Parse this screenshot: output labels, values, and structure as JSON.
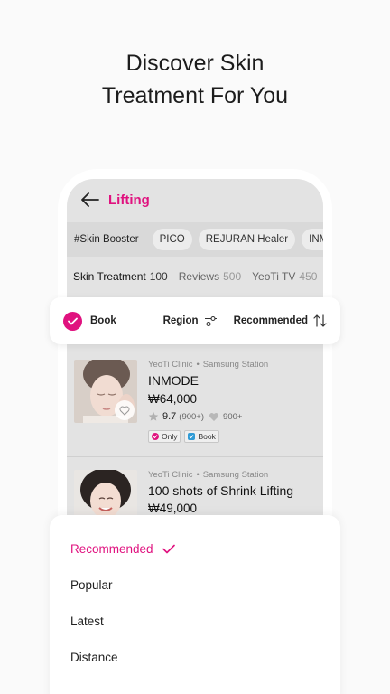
{
  "headline": {
    "line1": "Discover Skin",
    "line2": "Treatment For You"
  },
  "topbar": {
    "title": "Lifting"
  },
  "tags": [
    "#Skin Booster",
    "PICO",
    "REJURAN Healer",
    "INMODE"
  ],
  "subtabs": [
    {
      "label": "Skin Treatment",
      "count": "100"
    },
    {
      "label": "Reviews",
      "count": "500"
    },
    {
      "label": "YeoTi TV",
      "count": "450"
    }
  ],
  "filters": {
    "book": "Book",
    "region": "Region",
    "sort": "Recommended"
  },
  "items": [
    {
      "clinic": "YeoTi Clinic",
      "station": "Samsung Station",
      "title": "INMODE",
      "price": "₩64,000",
      "rating": "9.7",
      "rating_count": "(900+)",
      "likes": "900+",
      "badges": [
        "Only",
        "Book"
      ]
    },
    {
      "clinic": "YeoTi Clinic",
      "station": "Samsung Station",
      "title": "100 shots of Shrink Lifting",
      "price": "₩49,000"
    }
  ],
  "sort_sheet": {
    "options": [
      "Recommended",
      "Popular",
      "Latest",
      "Distance"
    ],
    "selected": "Recommended"
  },
  "colors": {
    "accent": "#e0127f",
    "badge_book": "#2f9bd6"
  }
}
